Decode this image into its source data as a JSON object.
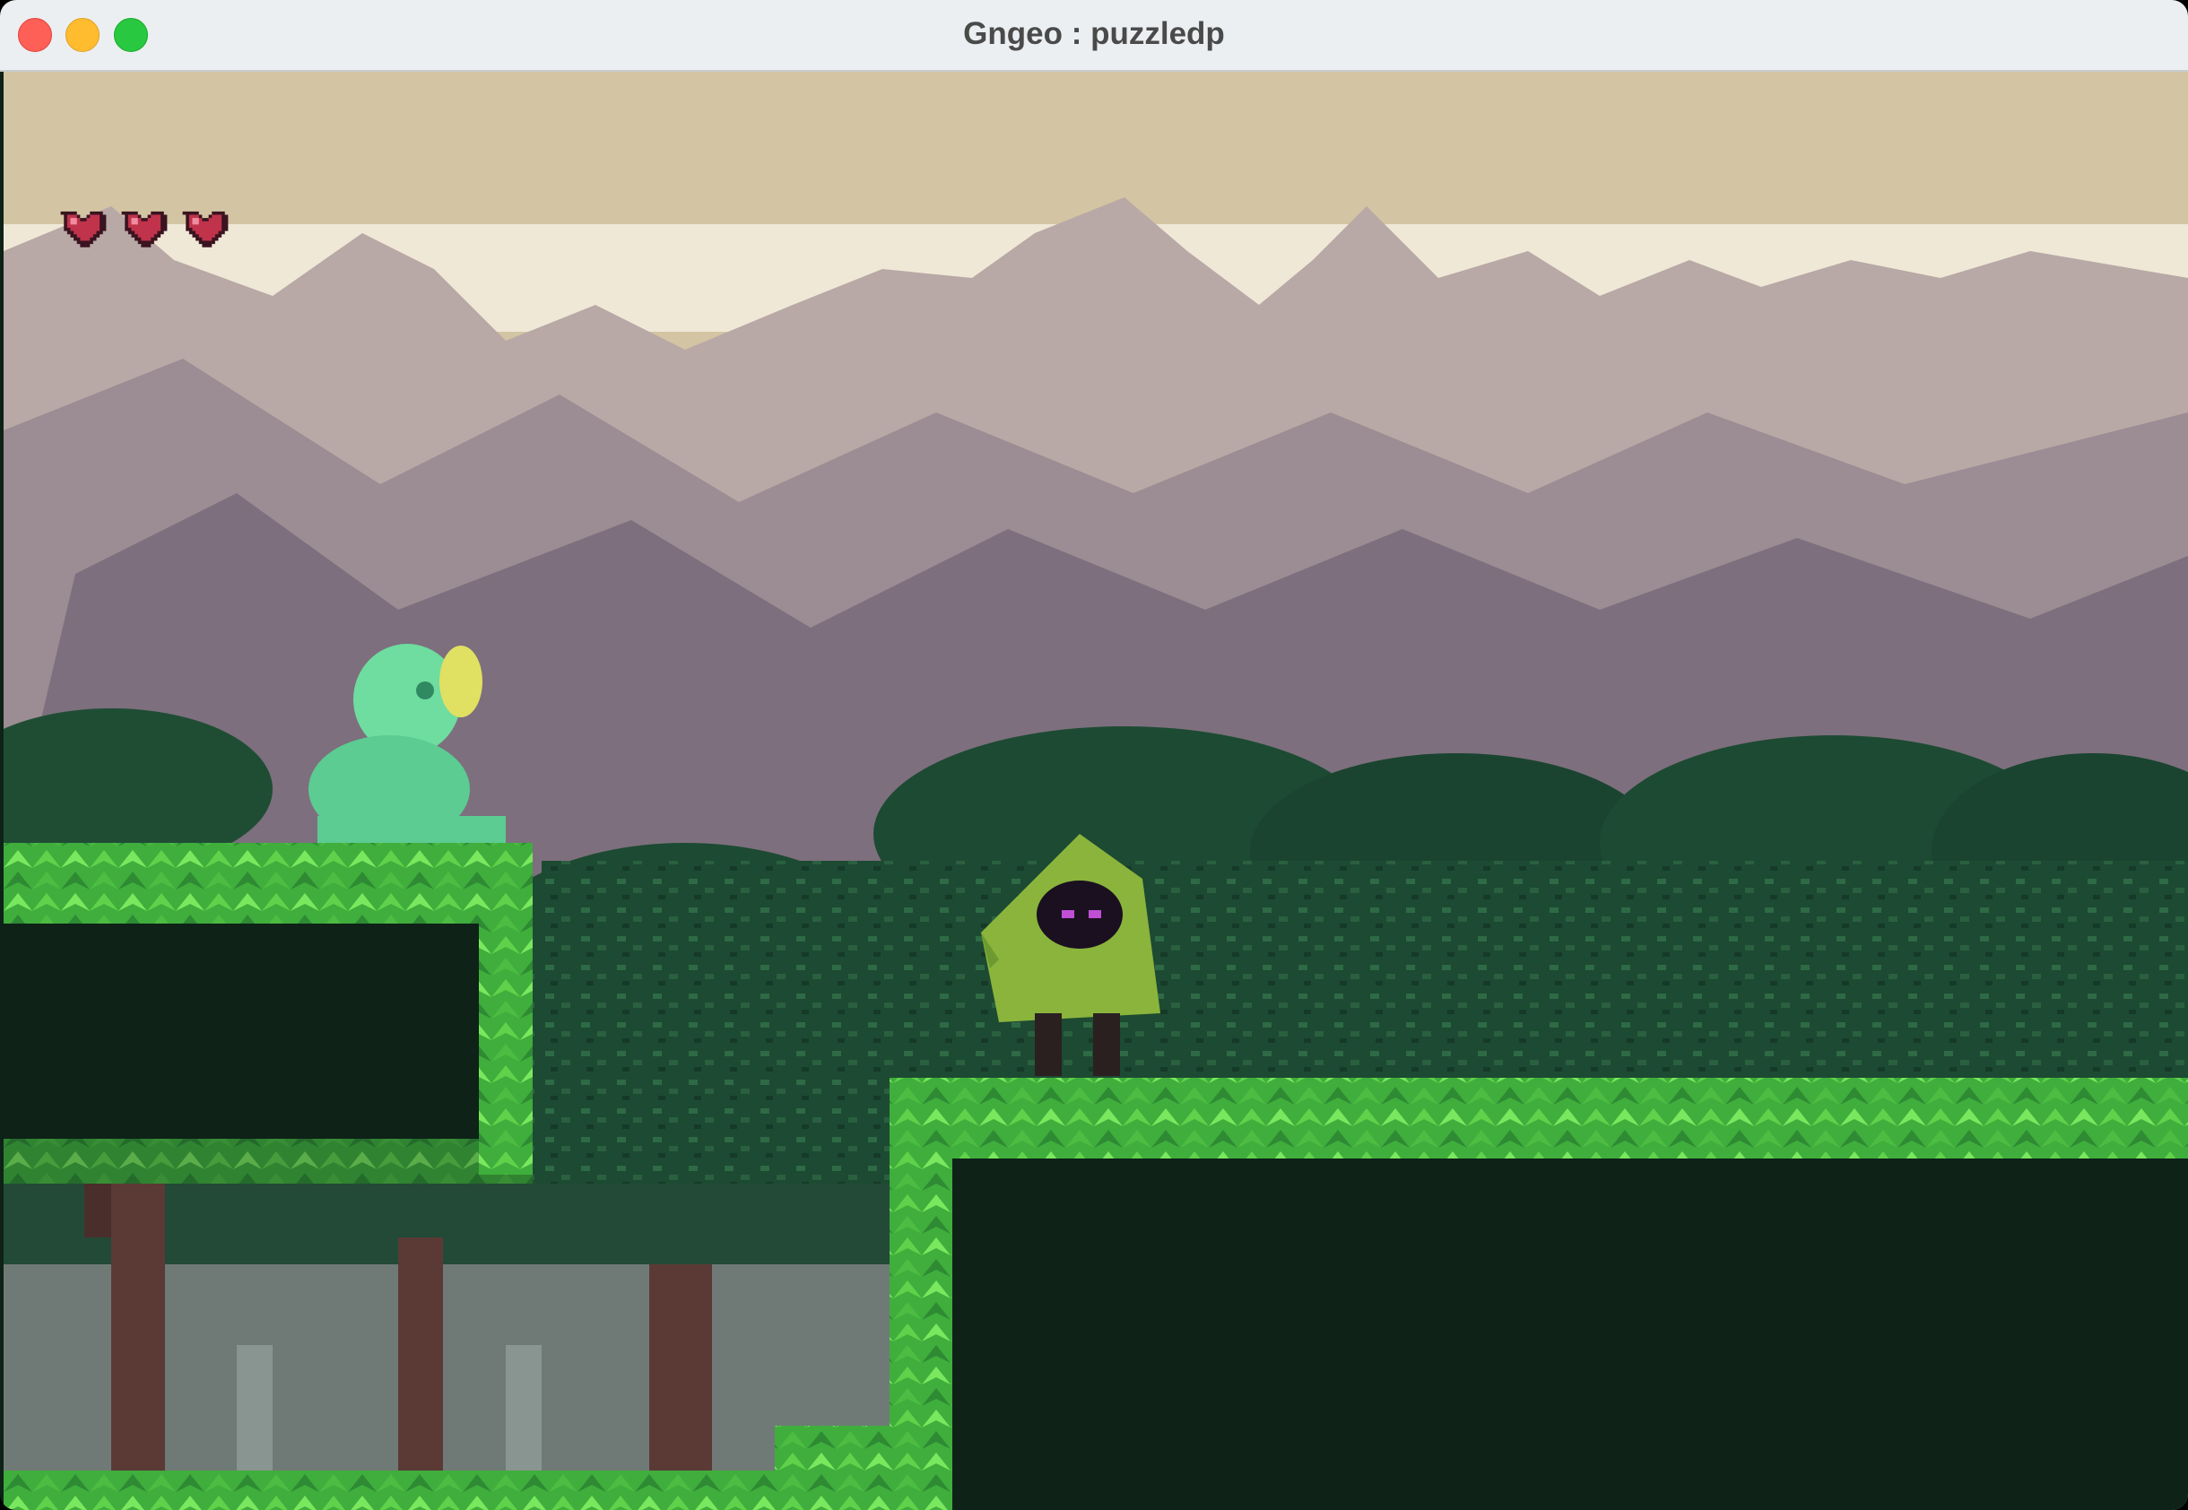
{
  "window": {
    "title": "Gngeo : puzzledp",
    "controls": [
      "close",
      "minimize",
      "maximize"
    ]
  },
  "hud": {
    "hearts": 3,
    "heart_color": "#c0334b"
  },
  "scene": {
    "sky_color": "#d3c5a3",
    "mountain_color": "#b5a5a5",
    "foliage_dark": "#0e2218",
    "leaf_light": "#6fe05a",
    "characters": [
      "slime-girl",
      "hooded-figure"
    ]
  }
}
